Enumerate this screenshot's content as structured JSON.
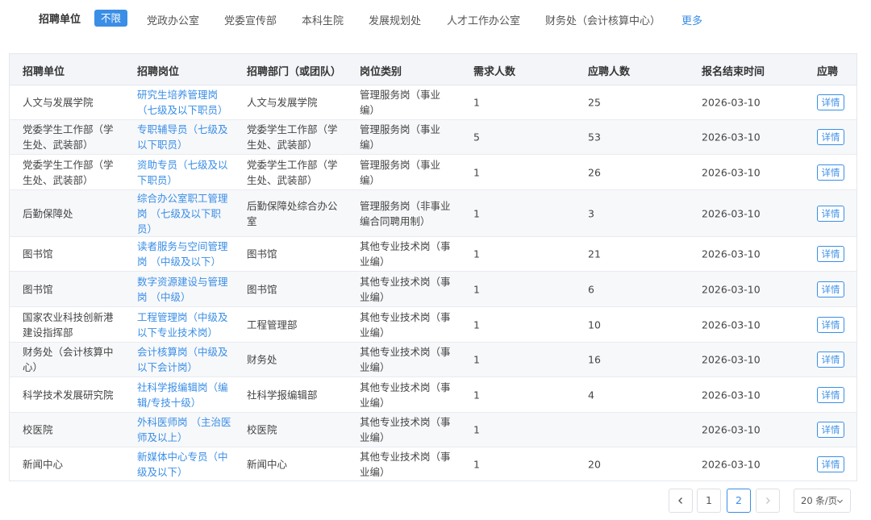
{
  "filter": {
    "title": "招聘单位",
    "items": [
      "不限",
      "党政办公室",
      "党委宣传部",
      "本科生院",
      "发展规划处",
      "人才工作办公室",
      "财务处（会计核算中心）"
    ],
    "more": "更多"
  },
  "table": {
    "headers": [
      "招聘单位",
      "招聘岗位",
      "招聘部门（或团队）",
      "岗位类别",
      "需求人数",
      "应聘人数",
      "报名结束时间",
      "应聘"
    ],
    "detail_label": "详情",
    "rows": [
      {
        "unit": "人文与发展学院",
        "post": "研究生培养管理岗\n（七级及以下职员）",
        "dept": "人文与发展学院",
        "category": "管理服务岗（事业\n编）",
        "need": "1",
        "applied": "25",
        "deadline": "2026-03-10"
      },
      {
        "unit": "党委学生工作部（学\n生处、武装部）",
        "post": "专职辅导员（七级及\n以下职员）",
        "dept": "党委学生工作部（学\n生处、武装部）",
        "category": "管理服务岗（事业\n编）",
        "need": "5",
        "applied": "53",
        "deadline": "2026-03-10"
      },
      {
        "unit": "党委学生工作部（学\n生处、武装部）",
        "post": "资助专员（七级及以\n下职员）",
        "dept": "党委学生工作部（学\n生处、武装部）",
        "category": "管理服务岗（事业\n编）",
        "need": "1",
        "applied": "26",
        "deadline": "2026-03-10"
      },
      {
        "unit": "后勤保障处",
        "post": "综合办公室职工管理\n岗 （七级及以下职\n员）",
        "dept": "后勤保障处综合办公\n室",
        "category": "管理服务岗（非事业\n编合同聘用制）",
        "need": "1",
        "applied": "3",
        "deadline": "2026-03-10"
      },
      {
        "unit": "图书馆",
        "post": "读者服务与空间管理\n岗 （中级及以下）",
        "dept": "图书馆",
        "category": "其他专业技术岗（事\n业编）",
        "need": "1",
        "applied": "21",
        "deadline": "2026-03-10"
      },
      {
        "unit": "图书馆",
        "post": "数字资源建设与管理\n岗 （中级）",
        "dept": "图书馆",
        "category": "其他专业技术岗（事\n业编）",
        "need": "1",
        "applied": "6",
        "deadline": "2026-03-10"
      },
      {
        "unit": "国家农业科技创新港\n建设指挥部",
        "post": "工程管理岗（中级及\n以下专业技术岗）",
        "dept": "工程管理部",
        "category": "其他专业技术岗（事\n业编）",
        "need": "1",
        "applied": "10",
        "deadline": "2026-03-10"
      },
      {
        "unit": "财务处（会计核算中\n心）",
        "post": "会计核算岗（中级及\n以下会计岗）",
        "dept": "财务处",
        "category": "其他专业技术岗（事\n业编）",
        "need": "1",
        "applied": "16",
        "deadline": "2026-03-10"
      },
      {
        "unit": "科学技术发展研究院",
        "post": "社科学报编辑岗（编\n辑/专技十级）",
        "dept": "社科学报编辑部",
        "category": "其他专业技术岗（事\n业编）",
        "need": "1",
        "applied": "4",
        "deadline": "2026-03-10"
      },
      {
        "unit": "校医院",
        "post": "外科医师岗 （主治医\n师及以上）",
        "dept": "校医院",
        "category": "其他专业技术岗（事\n业编）",
        "need": "1",
        "applied": "",
        "deadline": "2026-03-10"
      },
      {
        "unit": "新闻中心",
        "post": "新媒体中心专员（中\n级及以下）",
        "dept": "新闻中心",
        "category": "其他专业技术岗（事\n业编）",
        "need": "1",
        "applied": "20",
        "deadline": "2026-03-10"
      }
    ]
  },
  "pagination": {
    "pages": [
      "1",
      "2"
    ],
    "current_page": "2",
    "page_size": "20 条/页",
    "prev_icon": "chevron-left-icon",
    "next_icon": "chevron-right-icon",
    "size_icon": "chevron-down-icon"
  },
  "colors": {
    "accent": "#3a8ee6",
    "header_bg": "#f3f5f9",
    "alt_row_bg": "#f7f8fa",
    "border": "#e3e7ee"
  }
}
